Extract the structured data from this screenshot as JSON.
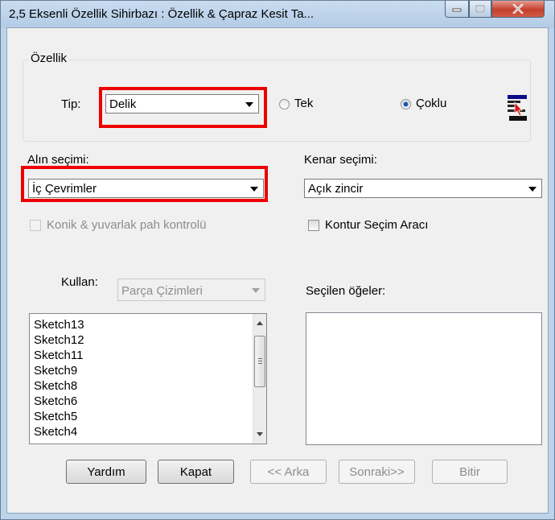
{
  "window": {
    "title": "2,5 Eksenli Özellik Sihirbazı : Özellik & Çapraz Kesit Ta...",
    "accent_color": "#bcd3ea",
    "close_color": "#c4402e",
    "highlight_color": "#ee0000"
  },
  "feature_group": {
    "legend": "Özellik",
    "type_label": "Tip:",
    "type_value": "Delik",
    "radio_single": "Tek",
    "radio_multi": "Çoklu",
    "selected_radio": "Çoklu",
    "icon": "selection-tool-icon"
  },
  "face_selection": {
    "label": "Alın seçimi:",
    "value": "İç Çevrimler"
  },
  "edge_selection": {
    "label": "Kenar seçimi:",
    "value": "Açık zincir"
  },
  "taper_check": {
    "label": "Konik & yuvarlak pah kontrolü",
    "checked": false,
    "enabled": false
  },
  "contour_check": {
    "label": "Kontur Seçim Aracı",
    "checked": false
  },
  "use": {
    "label": "Kullan:",
    "value": "Parça Çizimleri"
  },
  "sketch_list": {
    "items": [
      "Sketch13",
      "Sketch12",
      "Sketch11",
      "Sketch9",
      "Sketch8",
      "Sketch6",
      "Sketch5",
      "Sketch4"
    ]
  },
  "selected_items": {
    "label": "Seçilen öğeler:"
  },
  "buttons": {
    "help": "Yardım",
    "close": "Kapat",
    "back": "<< Arka",
    "next": "Sonraki>>",
    "finish": "Bitir"
  }
}
